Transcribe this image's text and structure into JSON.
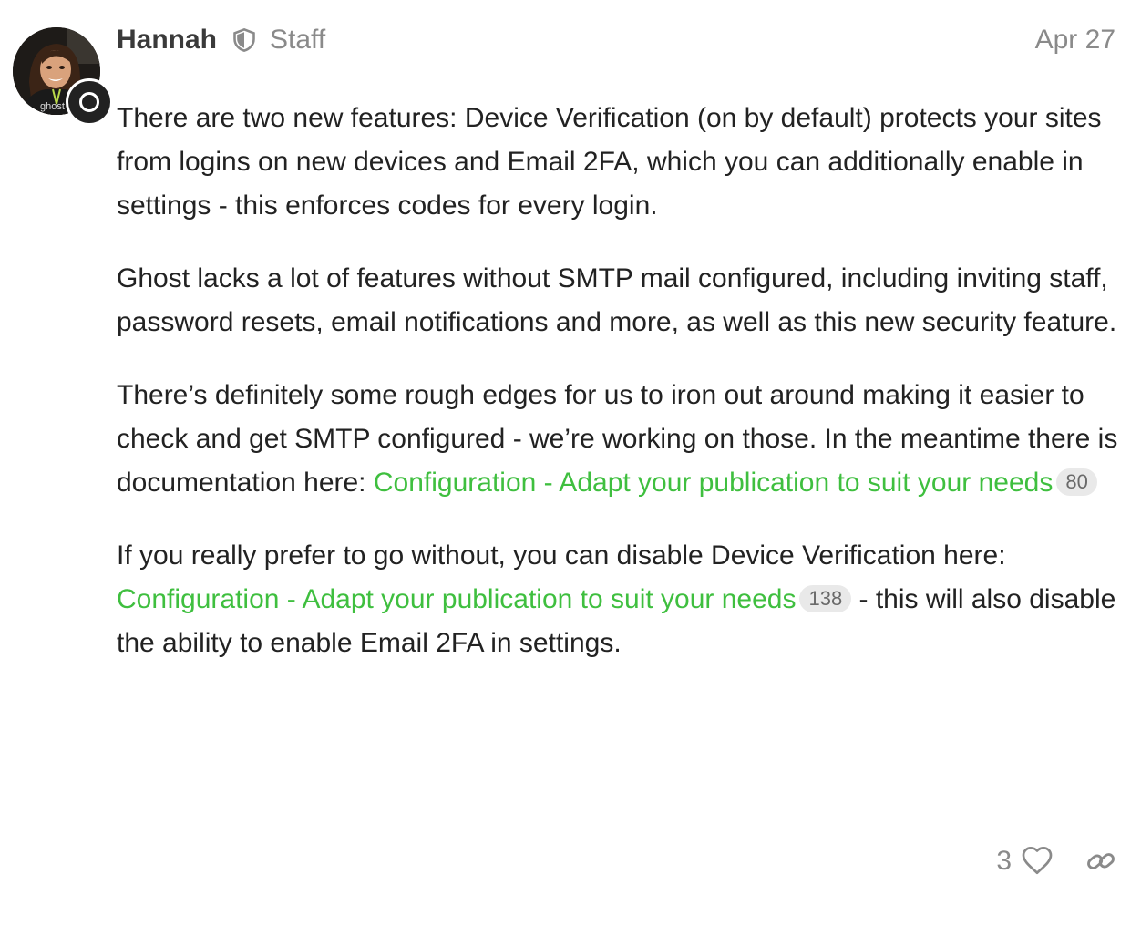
{
  "post": {
    "username": "Hannah",
    "user_title": "Staff",
    "date": "Apr 27",
    "avatar_text": "ghost",
    "paragraphs": {
      "p1": "There are two new features: Device Verification (on by default) protects your sites from logins on new devices and Email 2FA, which you can additionally enable in settings - this enforces codes for every login.",
      "p2": "Ghost lacks a lot of features without SMTP mail configured, including inviting staff, password resets, email notifications and more, as well as this new security feature.",
      "p3_text": "There’s definitely some rough edges for us to iron out around making it easier to check and get SMTP configured - we’re working on those. In the meantime there is documentation here: ",
      "p3_link": "Configuration - Adapt your publication to suit your needs",
      "p3_link_clicks": "80",
      "p4_text": "If you really prefer to go without, you can disable Device Verification here: ",
      "p4_link": "Configuration - Adapt your publication to suit your needs",
      "p4_link_clicks": "138",
      "p4_tail": " - this will also disable the ability to enable Email 2FA in settings."
    },
    "actions": {
      "like_count": "3"
    }
  },
  "icons": {
    "staff": "shield-icon",
    "like": "heart-icon",
    "share": "link-icon",
    "flair": "circle-icon"
  },
  "colors": {
    "link": "#3fbf3f",
    "muted": "#8a8a8a",
    "text": "#222222",
    "badge_bg": "#e9e9e9"
  }
}
